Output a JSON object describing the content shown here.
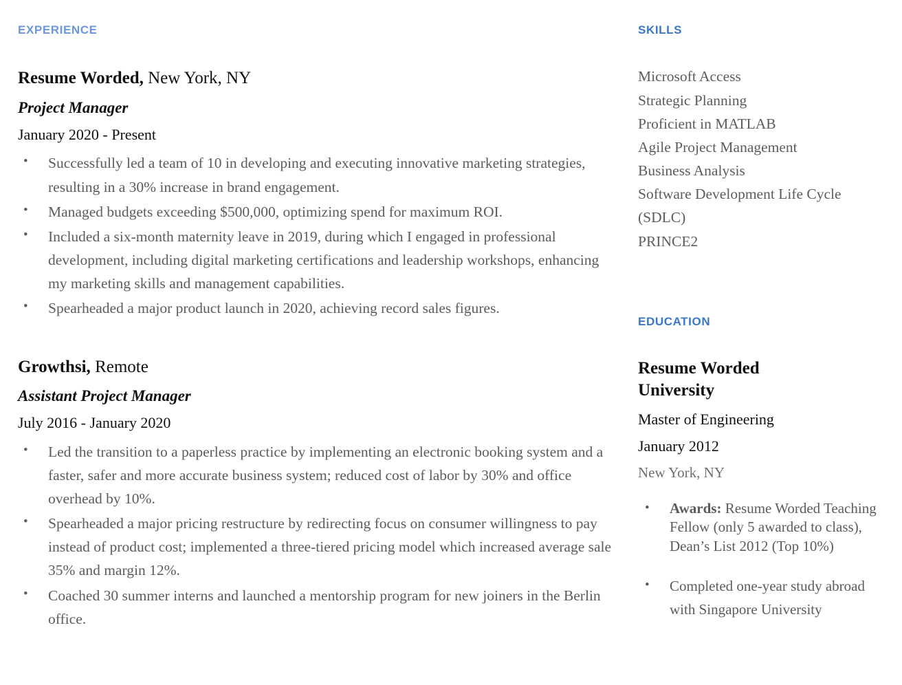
{
  "colors": {
    "experience_heading": "#6b96e0",
    "skills_heading": "#3878c8",
    "education_heading": "#3878c8",
    "body_text": "#5c5c5c",
    "strong_text": "#11100f"
  },
  "experience": {
    "heading": "EXPERIENCE",
    "entries": [
      {
        "company": "Resume Worded,",
        "location": " New York, NY",
        "title": "Project Manager",
        "dates": "January 2020 - Present",
        "bullets": [
          "Successfully led a team of 10 in developing and executing innovative marketing strategies, resulting in a 30% increase in brand engagement.",
          "Managed budgets exceeding $500,000, optimizing spend for maximum ROI.",
          "Included a six-month maternity leave in 2019, during which I engaged in professional development, including digital marketing certifications and leadership workshops, enhancing my marketing skills and management capabilities.",
          "Spearheaded a major product launch in 2020, achieving record sales figures."
        ]
      },
      {
        "company": "Growthsi,",
        "location": " Remote",
        "title": "Assistant Project Manager",
        "dates": "July 2016 - January 2020",
        "bullets": [
          "Led the transition to a paperless practice by implementing an electronic booking system and a faster, safer and more accurate business system; reduced cost of labor by 30% and office overhead by 10%.",
          "Spearheaded a major pricing restructure by redirecting focus on consumer willingness to pay instead of product cost; implemented a three-tiered pricing model which increased average sale 35% and margin 12%.",
          "Coached 30 summer interns and launched a mentorship program for new joiners in the Berlin office."
        ]
      }
    ]
  },
  "skills": {
    "heading": "SKILLS",
    "items": [
      "Microsoft Access",
      "Strategic Planning",
      "Proficient in MATLAB",
      "Agile Project Management",
      "Business Analysis",
      "Software Development Life Cycle (SDLC)",
      "PRINCE2"
    ]
  },
  "education": {
    "heading": "EDUCATION",
    "school": "Resume Worded University",
    "degree": "Master of Engineering",
    "date": "January 2012",
    "location": "New York, NY",
    "bullets": [
      {
        "lead": "Awards:",
        "text": " Resume Worded Teaching Fellow (only 5 awarded to class), Dean’s List 2012 (Top 10%)"
      },
      {
        "lead": "",
        "text": "Completed one-year study abroad with Singapore University"
      }
    ]
  }
}
